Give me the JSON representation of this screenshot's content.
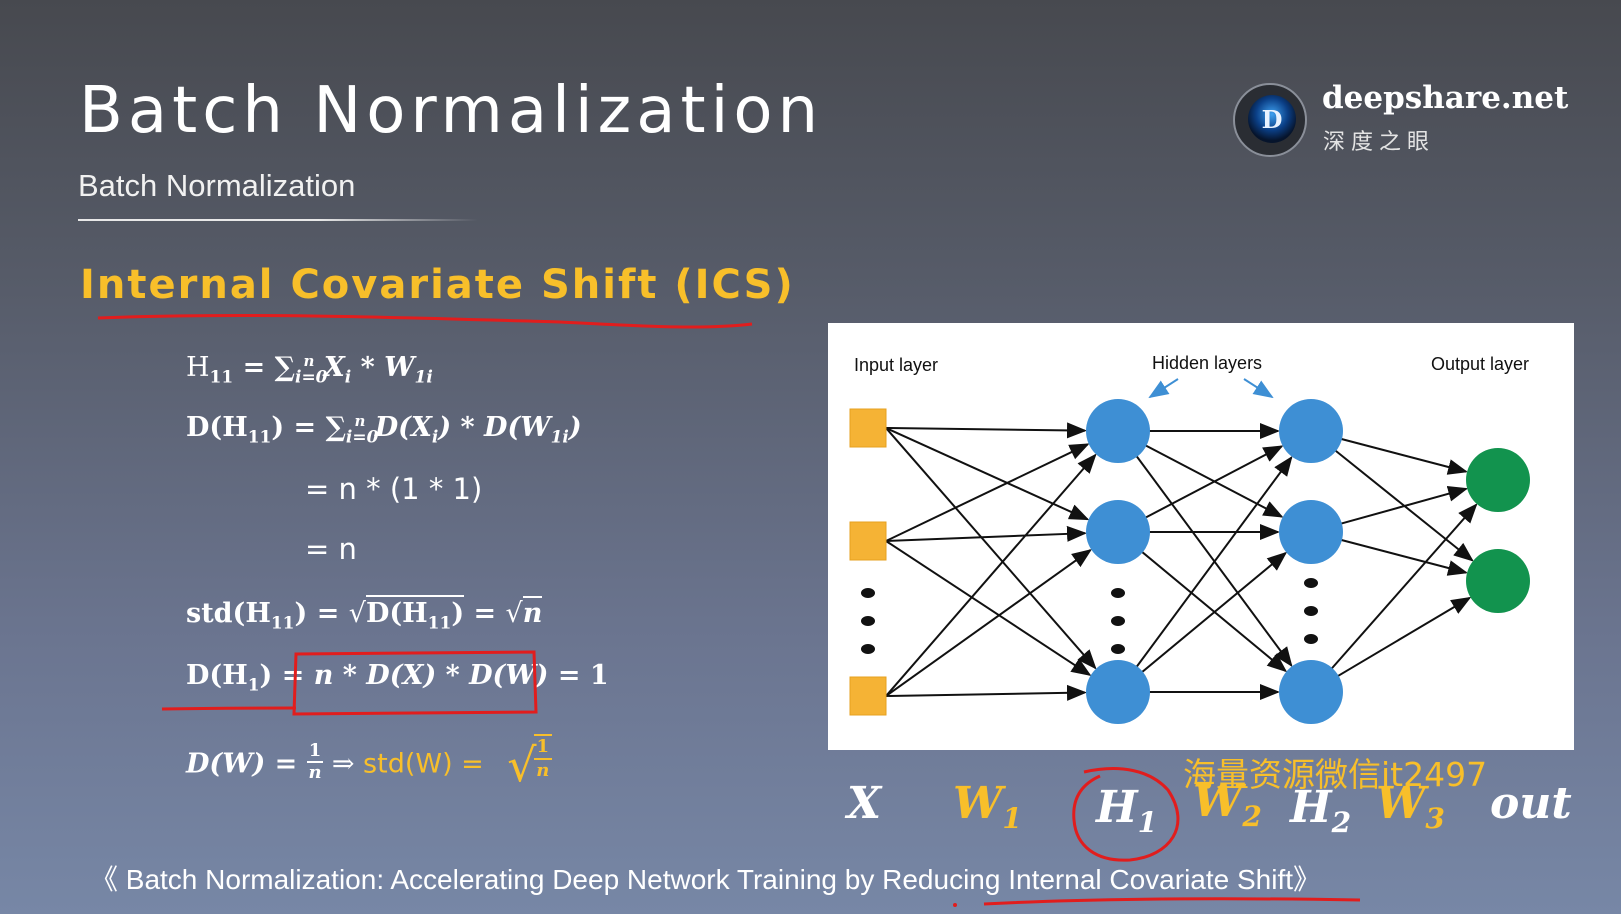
{
  "header": {
    "title": "Batch Normalization",
    "subtitle": "Batch Normalization"
  },
  "logo": {
    "name": "deepshare.net",
    "chinese": "深度之眼",
    "badge_letter": "D"
  },
  "section": {
    "heading": "Internal Covariate Shift (ICS)"
  },
  "equations": {
    "h11": {
      "lhs": "H",
      "lhs_sub": "11",
      "eq": " = ∑",
      "sum_sub": "i=0",
      "sum_sup": "n",
      "x": "X",
      "x_sub": "i",
      "star": " * ",
      "w": "W",
      "w_sub": "1i"
    },
    "dh11": {
      "text": "D(H",
      "sub": "11",
      "rest": ") = ∑",
      "sum_sub": "i=0",
      "sum_sup": "n",
      "tail": "D(X",
      "tail_sub": "i",
      "tail2": ") * D(W",
      "tail2_sub": "1i",
      "tail3": ")"
    },
    "line3": "= n * (1 * 1)",
    "line4": "= n",
    "std": {
      "a": "std(H",
      "a_sub": "11",
      "b": ") = ",
      "c": "D(H",
      "c_sub": "11",
      "d": ")",
      "e": " = ",
      "f": "n"
    },
    "dh1": {
      "a": "D(H",
      "a_sub": "1",
      "b": ") = ",
      "box": "n * D(X) * D(W)",
      "c": " = 1"
    },
    "dw": {
      "a": "D(W) = ",
      "num": "1",
      "den": "n",
      "arrow": " ⇒ ",
      "std": "std(W)  =",
      "root_num": "1",
      "root_den": "n"
    }
  },
  "diagram": {
    "input_label": "Input layer",
    "hidden_label": "Hidden layers",
    "output_label": "Output layer",
    "colors": {
      "input": "#f5b335",
      "hidden": "#3e8fd4",
      "output": "#12934e",
      "arrow": "#111111"
    }
  },
  "labels": {
    "x": "X",
    "w1": "W",
    "w1_sub": "1",
    "h1": "H",
    "h1_sub": "1",
    "w2": "W",
    "w2_sub": "2",
    "h2": "H",
    "h2_sub": "2",
    "w3": "W",
    "w3_sub": "3",
    "out": "out"
  },
  "watermark": "海量资源微信it2497",
  "citation": "《 Batch Normalization: Accelerating Deep Network Training by Reducing Internal Covariate Shift》",
  "colors": {
    "accent": "#f8bf2a",
    "annotation": "#e11d1d"
  }
}
